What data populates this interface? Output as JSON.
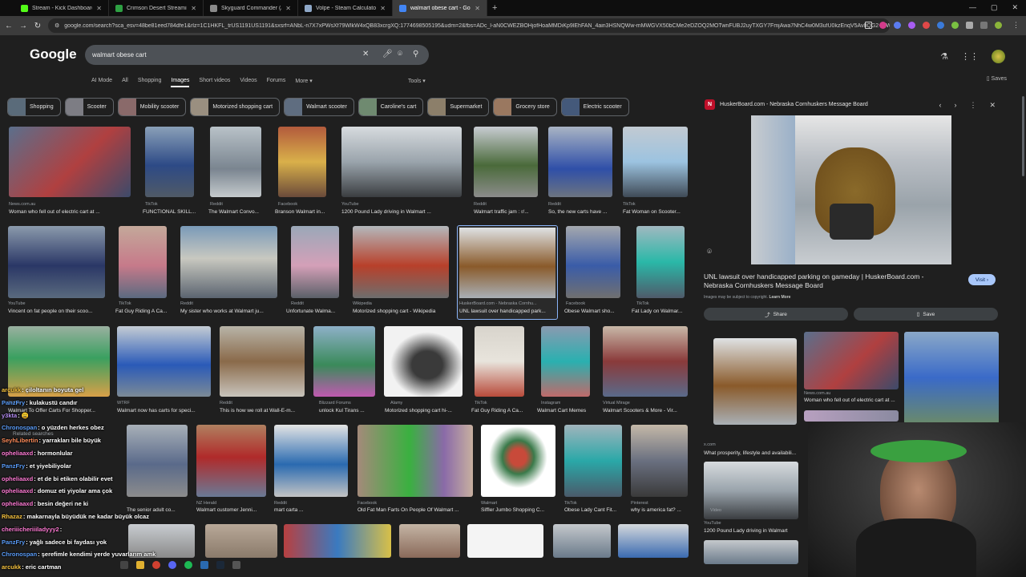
{
  "browser": {
    "tabs": [
      {
        "title": "Stream - Kick Dashboard",
        "color": "#53fc18"
      },
      {
        "title": "Crimson Desert Streaming - Li...",
        "color": "#2ea043"
      },
      {
        "title": "Skyguard Commander (AC) - A...",
        "color": "#8a8a8a"
      },
      {
        "title": "Volpe - Steam Calculator - 765...",
        "color": "#8fa8c8"
      },
      {
        "title": "walmart obese cart - Google S...",
        "color": "#4285f4"
      }
    ],
    "new_tab": "+",
    "url": "google.com/search?sca_esv=48be81eed784dfe1&rlz=1C1HKFL_trUS1191US1191&sxsrf=ANbL-n7X7xPWsXf79WlkW4xQB83xcrgXQ:1774698505195&udm=2&fbs=ADc_l-aN0CWEZBOHjofHoaMMDiKp9lEhFAN_4ain3HSNQWw-mMWGVX50bCMe2eDZOQ2MOTwnFUBJ2uyTXGY7FmjAwa7NhC4w0M3ufU0kzEnqV5Av8QG2+UWFIM2J..."
  },
  "google": {
    "logo": "Google",
    "query": "walmart obese cart",
    "nav": [
      "AI Mode",
      "All",
      "Shopping",
      "Images",
      "Short videos",
      "Videos",
      "Forums",
      "More"
    ],
    "active_nav": "Images",
    "tools": "Tools",
    "saves": "Saves"
  },
  "chips": [
    "Shopping",
    "Scooter",
    "Mobility scooter",
    "Motorized shopping cart",
    "Walmart scooter",
    "Caroline's cart",
    "Supermarket",
    "Grocery store",
    "Electric scooter"
  ],
  "results": {
    "row1": [
      {
        "src": "News.com.au",
        "cap": "Woman who fell out of electric cart at ..."
      },
      {
        "src": "TikTok",
        "cap": "FUNCTIONAL SKILL..."
      },
      {
        "src": "Reddit",
        "cap": "The Walmart Convo..."
      },
      {
        "src": "Facebook",
        "cap": "Branson Walmart in..."
      },
      {
        "src": "YouTube",
        "cap": "1200 Pound Lady driving in Walmart ..."
      },
      {
        "src": "Reddit",
        "cap": "Walmart traffic jam : r/..."
      },
      {
        "src": "Reddit",
        "cap": "So, the new carts have ..."
      },
      {
        "src": "TikTok",
        "cap": "Fat Woman on Scooter..."
      }
    ],
    "row2": [
      {
        "src": "YouTube",
        "cap": "Vincent on fat people on their scoo..."
      },
      {
        "src": "TikTok",
        "cap": "Fat Guy Riding A Ca..."
      },
      {
        "src": "Reddit",
        "cap": "My sister who works at Walmart ju..."
      },
      {
        "src": "Reddit",
        "cap": "Unfortunate Walma..."
      },
      {
        "src": "Wikipedia",
        "cap": "Motorized shopping cart - Wikipedia"
      },
      {
        "src": "HuskerBoard.com - Nebraska Cornhu...",
        "cap": "UNL lawsuit over handicapped park..."
      },
      {
        "src": "Facebook",
        "cap": "Obese Walmart sho..."
      },
      {
        "src": "TikTok",
        "cap": "Fat Lady on Walmar..."
      }
    ],
    "row3": [
      {
        "src": "TikTok",
        "cap": "Walmart To Offer Carts For Shopper..."
      },
      {
        "src": "WTRF",
        "cap": "Walmart now has carts for speci..."
      },
      {
        "src": "Reddit",
        "cap": "This is how we roll at Wall-E-m..."
      },
      {
        "src": "Blizzard Forums",
        "cap": "unlock Kul Tirans ..."
      },
      {
        "src": "Alamy",
        "cap": "Motorized shopping cart hi-..."
      },
      {
        "src": "TikTok",
        "cap": "Fat Guy Riding A Ca..."
      },
      {
        "src": "Instagram",
        "cap": "Walmart Cart Memes"
      },
      {
        "src": "Virtual Mirage",
        "cap": "Walmart Scooters & More - Vir..."
      }
    ],
    "row4": [
      {
        "src": "",
        "cap": "Related searches"
      },
      {
        "src": "",
        "cap": "The senior adult co..."
      },
      {
        "src": "NZ Herald",
        "cap": "Walmart customer Jenni..."
      },
      {
        "src": "Reddit",
        "cap": "mart carta ..."
      },
      {
        "src": "Facebook",
        "cap": "Old Fat Man Farts On People Of Walmart ..."
      },
      {
        "src": "Walmart",
        "cap": "Siffler Jumbo Shopping C..."
      },
      {
        "src": "TikTok",
        "cap": "Obese Lady Cant Fit..."
      },
      {
        "src": "Pinterest",
        "cap": "why is america fat? ..."
      }
    ]
  },
  "panel": {
    "source": "HuskerBoard.com - Nebraska Cornhuskers Message Board",
    "title": "UNL lawsuit over handicapped parking on gameday | HuskerBoard.com - Nebraska Cornhuskers Message Board",
    "visit": "Visit",
    "copyright": "Images may be subject to copyright.",
    "learn_more": "Learn More",
    "share": "Share",
    "save": "Save",
    "related": [
      {
        "src": "News.com.au",
        "cap": "Woman who fell out of electric cart at ..."
      },
      {
        "src": "x.com",
        "cap": "What prosperity, lifestyle and availabili..."
      },
      {
        "src": "YouTube",
        "cap": "1200 Pound Lady driving in Walmart"
      },
      {
        "src": "",
        "cap": "Video"
      }
    ]
  },
  "chat": [
    {
      "user": "arcukk",
      "msg": ": çiloltanın boyuta gel",
      "color": "#f6c23e"
    },
    {
      "user": "PanzFry",
      "msg": ": kulakustü candır",
      "color": "#5a9cf8"
    },
    {
      "user": "y3kta",
      "msg": ": 😩",
      "color": "#b48cf2"
    },
    {
      "user": "Chronospan",
      "msg": ": o yüzden herkes obez",
      "color": "#5a9cf8"
    },
    {
      "user": "SeyhLibertin",
      "msg": ": yarrakları bile büyük",
      "color": "#ff8c5a"
    },
    {
      "user": "opheliaaxd",
      "msg": ": hormonlular",
      "color": "#ff7bd5"
    },
    {
      "user": "PanzFry",
      "msg": ": et yiyebiliyolar",
      "color": "#5a9cf8"
    },
    {
      "user": "opheliaaxd",
      "msg": ": et de bi etiken olabilir evet",
      "color": "#ff7bd5"
    },
    {
      "user": "opheliaaxd",
      "msg": ": domuz eti yiyolar ama çok",
      "color": "#ff7bd5"
    },
    {
      "user": "opheliaaxd",
      "msg": ": besin değeri ne ki",
      "color": "#ff7bd5"
    },
    {
      "user": "Rhazaz",
      "msg": ": makarnayla büyüdük ne kadar büyük olcaz",
      "color": "#f6c23e"
    },
    {
      "user": "cheriiicheriiiladyyy2",
      "msg": ":",
      "color": "#ff7bd5"
    },
    {
      "user": "PanzFry",
      "msg": ": yağlı sadece bi faydası yok",
      "color": "#5a9cf8"
    },
    {
      "user": "Chronospan",
      "msg": ": şerefimle kendimi yerde yuvarlarım amk",
      "color": "#5a9cf8"
    },
    {
      "user": "arcukk",
      "msg": ": eric cartman",
      "color": "#f6c23e"
    }
  ],
  "colors": {
    "page_bg": "#1f1f1f",
    "accent": "#a8c7fa",
    "tabbar": "#0e0e0e"
  }
}
